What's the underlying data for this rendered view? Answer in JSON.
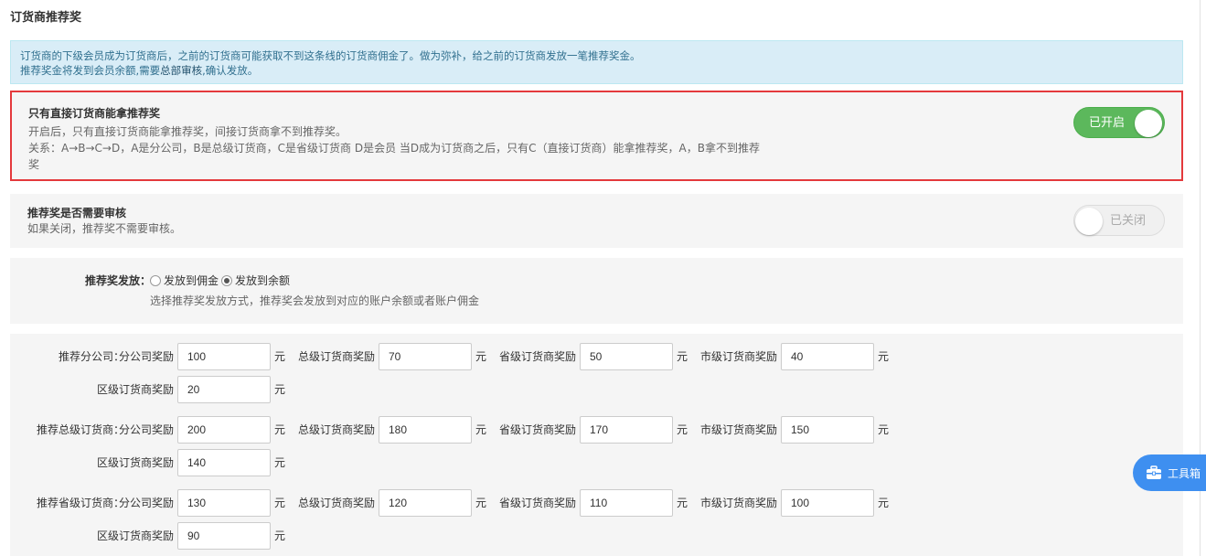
{
  "page": {
    "title": "订货商推荐奖"
  },
  "info": {
    "line1": "订货商的下级会员成为订货商后，之前的订货商可能获取不到这条线的订货商佣金了。做为弥补，给之前的订货商发放一笔推荐奖金。",
    "line2_a": "推荐奖金将发到会员余额,需要",
    "line2_b": "总部审核",
    "line2_c": ",确认发放。"
  },
  "direct_only": {
    "title": "只有直接订货商能拿推荐奖",
    "desc1": "开启后，只有直接订货商能拿推荐奖，间接订货商拿不到推荐奖。",
    "desc2": "关系：A→B→C→D，A是分公司，B是总级订货商，C是省级订货商 D是会员 当D成为订货商之后，只有C（直接订货商）能拿推荐奖，A，B拿不到推荐奖",
    "toggle_label": "已开启",
    "toggle_on": true
  },
  "need_review": {
    "title": "推荐奖是否需要审核",
    "desc": "如果关闭，推荐奖不需要审核。",
    "toggle_label": "已关闭",
    "toggle_on": false
  },
  "payout": {
    "label": "推荐奖发放：",
    "options": [
      "发放到佣金",
      "发放到余额"
    ],
    "selected": 1,
    "hint": "选择推荐奖发放方式，推荐奖会发放到对应的账户余额或者账户佣金"
  },
  "rewards": {
    "unit": "元",
    "field_labels": {
      "company": "分公司奖励",
      "general": "总级订货商奖励",
      "province": "省级订货商奖励",
      "city": "市级订货商奖励",
      "district": "区级订货商奖励"
    },
    "groups": [
      {
        "label": "推荐分公司：",
        "company": "100",
        "general": "70",
        "province": "50",
        "city": "40",
        "district": "20"
      },
      {
        "label": "推荐总级订货商：",
        "company": "200",
        "general": "180",
        "province": "170",
        "city": "150",
        "district": "140"
      },
      {
        "label": "推荐省级订货商：",
        "company": "130",
        "general": "120",
        "province": "110",
        "city": "100",
        "district": "90"
      }
    ]
  },
  "toolbox": {
    "label": "工具箱"
  },
  "colors": {
    "toggle_on": "#5cb85c",
    "highlight_border": "#e4393c",
    "info_bg": "#d9edf7",
    "toolbox_bg": "#3e8ff0"
  }
}
